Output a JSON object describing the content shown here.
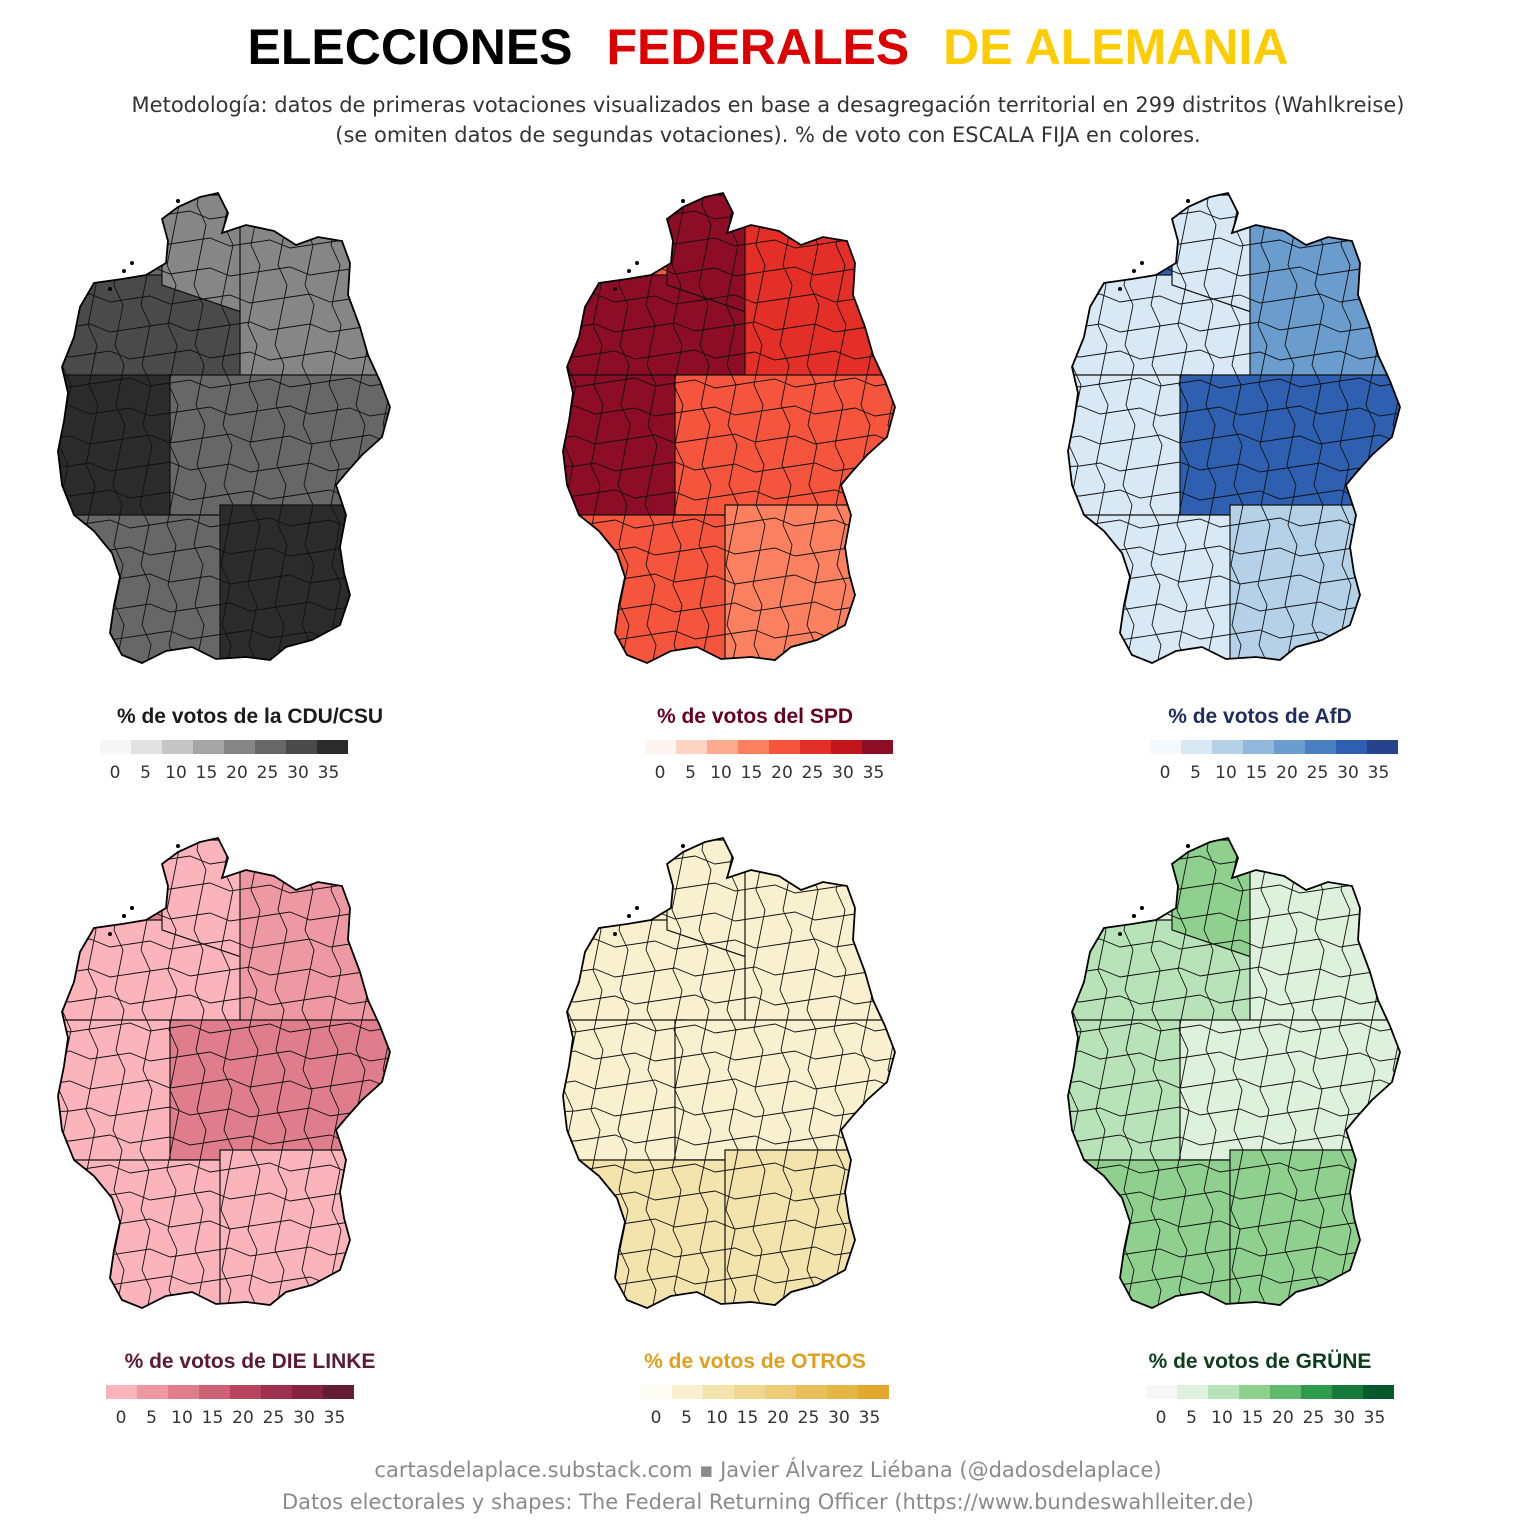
{
  "title": {
    "part1": "ELECCIONES",
    "part2": "FEDERALES",
    "part3": "DE ALEMANIA",
    "color1": "#000000",
    "color2": "#dd0000",
    "color3": "#ffcc00"
  },
  "subtitle": {
    "line1": "Metodología: datos de primeras votaciones visualizados en base a desagregación territorial en 299 distritos (Wahlkreise)",
    "line2": "(se omiten datos de segundas votaciones). % de voto con ESCALA FIJA en colores."
  },
  "legend_ticks": [
    "0",
    "5",
    "10",
    "15",
    "20",
    "25",
    "30",
    "35"
  ],
  "maps": [
    {
      "party": "CDU/CSU",
      "label": "% de votos de la CDU/CSU",
      "label_color": "#1a1a1a",
      "palette": [
        "#f7f7f7",
        "#e2e2e2",
        "#c6c6c6",
        "#a5a5a5",
        "#868686",
        "#676767",
        "#4a4a4a",
        "#2b2b2b"
      ],
      "regions": {
        "north": 4,
        "northwest": 6,
        "west": 7,
        "east": 4,
        "center": 5,
        "south": 7,
        "southwest": 5
      }
    },
    {
      "party": "SPD",
      "label": "% de votos del SPD",
      "label_color": "#67001f",
      "palette": [
        "#fff5f0",
        "#fdd3c1",
        "#fcab8f",
        "#fb8060",
        "#f5553c",
        "#e32f27",
        "#c0161c",
        "#8c0d25"
      ],
      "regions": {
        "north": 7,
        "northwest": 7,
        "west": 7,
        "east": 5,
        "center": 4,
        "south": 3,
        "southwest": 4
      }
    },
    {
      "party": "AfD",
      "label": "% de votos de AfD",
      "label_color": "#1f2e5e",
      "palette": [
        "#f4f9fe",
        "#d9e8f5",
        "#b4d1e8",
        "#91b7dc",
        "#6a9ccd",
        "#4a7fc0",
        "#2f5fb0",
        "#25448c"
      ],
      "regions": {
        "north": 1,
        "northwest": 1,
        "west": 1,
        "east": 4,
        "center": 6,
        "south": 2,
        "southwest": 1
      }
    },
    {
      "party": "DIE LINKE",
      "label": "% de votos de DIE LINKE",
      "label_color": "#5c1a33",
      "palette": [
        "#fbb4bc",
        "#ee98a4",
        "#df7d8c",
        "#cc6075",
        "#b6445f",
        "#9c304e",
        "#822440",
        "#651c35"
      ],
      "regions": {
        "north": 0,
        "northwest": 0,
        "west": 0,
        "east": 1,
        "center": 2,
        "south": 0,
        "southwest": 0
      }
    },
    {
      "party": "OTROS",
      "label": "% de votos de OTROS",
      "label_color": "#e0a01d",
      "palette": [
        "#fdfcf5",
        "#f9f0cf",
        "#f3e3ad",
        "#efd792",
        "#eccb78",
        "#e8bf5b",
        "#e3b446",
        "#e0a82d"
      ],
      "regions": {
        "north": 1,
        "northwest": 1,
        "west": 1,
        "east": 1,
        "center": 1,
        "south": 2,
        "southwest": 2
      }
    },
    {
      "party": "GRÜNE",
      "label": "% de votos de GRÜNE",
      "label_color": "#0d3d1e",
      "palette": [
        "#f7f7f7",
        "#ddf1dd",
        "#b8e2b8",
        "#8fd08f",
        "#60b96c",
        "#2f9a4d",
        "#16793a",
        "#07582a"
      ],
      "regions": {
        "north": 3,
        "northwest": 2,
        "west": 2,
        "east": 1,
        "center": 1,
        "south": 3,
        "southwest": 3
      }
    }
  ],
  "footer": {
    "line1": "cartasdelaplace.substack.com ▪ Javier Álvarez Liébana (@dadosdelaplace)",
    "line2": "Datos electorales y shapes: The Federal Returning Officer (https://www.bundeswahlleiter.de)"
  }
}
